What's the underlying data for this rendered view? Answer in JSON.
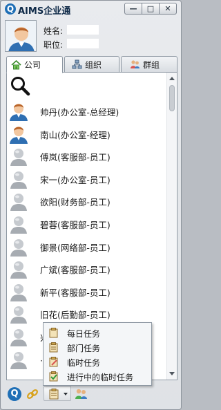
{
  "window": {
    "logo_letter": "Q",
    "title": "AIMS企业通",
    "btn_minimize": "—",
    "btn_maximize": "□",
    "btn_close": "✕"
  },
  "profile": {
    "name_label": "姓名:",
    "title_label": "职位:"
  },
  "tabs": [
    {
      "label": "公司",
      "icon": "home-icon"
    },
    {
      "label": "组织",
      "icon": "org-icon"
    },
    {
      "label": "群组",
      "icon": "group-icon"
    }
  ],
  "search": {
    "placeholder": ""
  },
  "contacts": [
    {
      "name": "帅丹(办公室-总经理)",
      "avatar": "person-color"
    },
    {
      "name": "南山(办公室-经理)",
      "avatar": "person-color"
    },
    {
      "name": "傅岚(客服部-员工)",
      "avatar": "person-gray"
    },
    {
      "name": "宋一(办公室-员工)",
      "avatar": "person-gray"
    },
    {
      "name": "欲阳(财务部-员工)",
      "avatar": "person-gray"
    },
    {
      "name": "碧蓉(客服部-员工)",
      "avatar": "person-gray"
    },
    {
      "name": "御景(网络部-员工)",
      "avatar": "person-gray"
    },
    {
      "name": "广斌(客服部-员工)",
      "avatar": "person-gray"
    },
    {
      "name": "新平(客服部-员工)",
      "avatar": "person-gray"
    },
    {
      "name": "旧花(后勤部-员工)",
      "avatar": "person-gray"
    },
    {
      "name": "兴",
      "avatar": "person-gray"
    },
    {
      "name": "·某",
      "avatar": "person-gray"
    }
  ],
  "context_menu": [
    {
      "label": "每日任务",
      "icon": "daily-task-icon"
    },
    {
      "label": "部门任务",
      "icon": "dept-task-icon"
    },
    {
      "label": "临时任务",
      "icon": "temp-task-icon"
    },
    {
      "label": "进行中的临时任务",
      "icon": "in-progress-task-icon"
    }
  ],
  "bottombar": {
    "logo_letter": "Q"
  },
  "colors": {
    "accent": "#1f6fb6",
    "titlebar_text": "#0f2a48",
    "panel_border": "#8e98a3"
  }
}
